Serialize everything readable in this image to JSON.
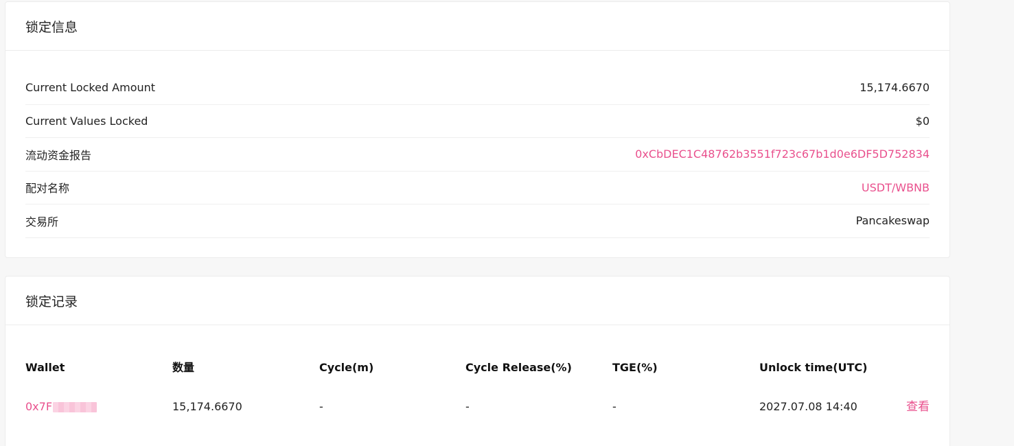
{
  "lock_info": {
    "title": "锁定信息",
    "rows": [
      {
        "label": "Current Locked Amount",
        "value": "15,174.6670"
      },
      {
        "label": "Current Values Locked",
        "value": "$0"
      },
      {
        "label": "流动资金报告",
        "value": "0xCbDEC1C48762b3551f723c67b1d0e6DF5D752834"
      },
      {
        "label": "配对名称",
        "value": "USDT/WBNB"
      },
      {
        "label": "交易所",
        "value": "Pancakeswap"
      }
    ]
  },
  "lock_records": {
    "title": "锁定记录",
    "columns": [
      "Wallet",
      "数量",
      "Cycle(m)",
      "Cycle Release(%)",
      "TGE(%)",
      "Unlock time(UTC)"
    ],
    "rows": [
      {
        "wallet": "0x7F",
        "amount": "15,174.6670",
        "cycle": "-",
        "cycle_release": "-",
        "tge": "-",
        "unlock_time": "2027.07.08 14:40",
        "action": "查看"
      }
    ]
  },
  "colors": {
    "accent": "#e9508d",
    "background": "#f7f7f7",
    "card": "#ffffff"
  }
}
